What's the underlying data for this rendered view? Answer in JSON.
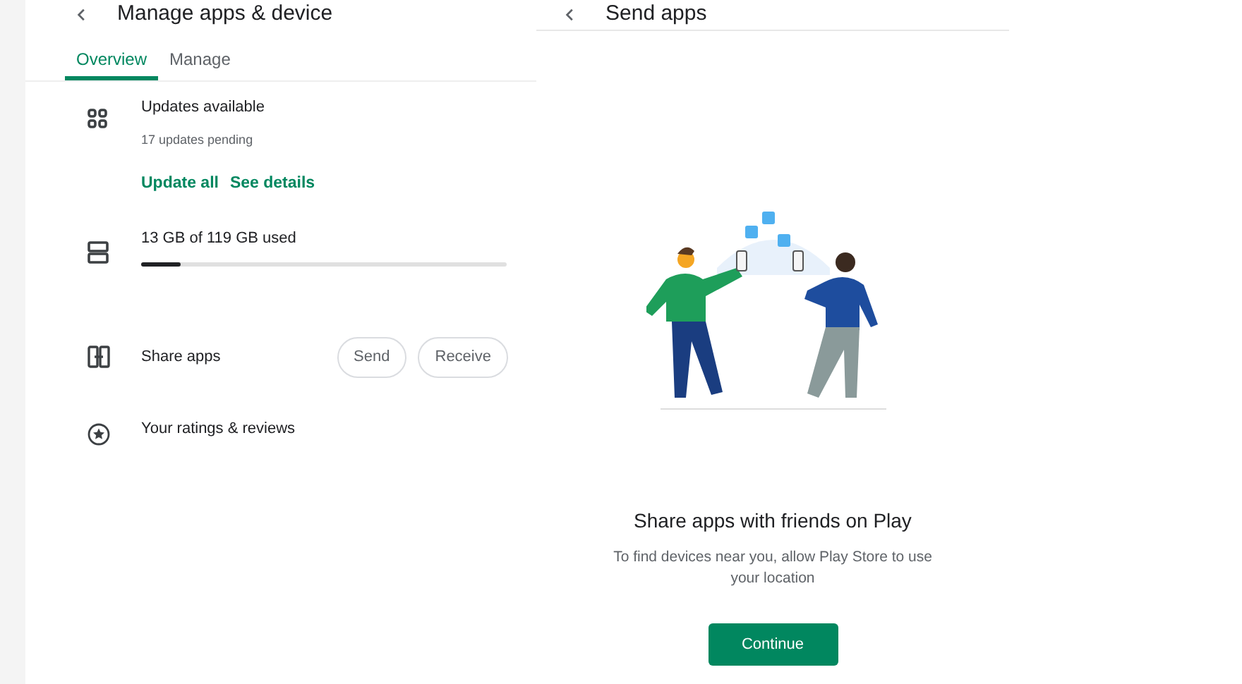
{
  "left_panel": {
    "title": "Manage apps & device",
    "tabs": [
      {
        "label": "Overview",
        "selected": true
      },
      {
        "label": "Manage",
        "selected": false
      }
    ],
    "sections": [
      {
        "kind": "updates",
        "title": "Updates available",
        "subtitle": "17 updates pending",
        "actions": [
          "Update all",
          "See details"
        ]
      },
      {
        "kind": "storage",
        "title": "13 GB of 119 GB used",
        "level": 0.11
      },
      {
        "kind": "share",
        "title": "Share apps",
        "buttons": [
          "Send",
          "Receive"
        ]
      },
      {
        "kind": "ratings",
        "title": "Your ratings & reviews"
      }
    ]
  },
  "right_panel": {
    "title": "Send apps",
    "heading": "Share apps with friends on Play",
    "message": "To find devices near you, allow Play Store to use your location",
    "button": "Continue"
  }
}
